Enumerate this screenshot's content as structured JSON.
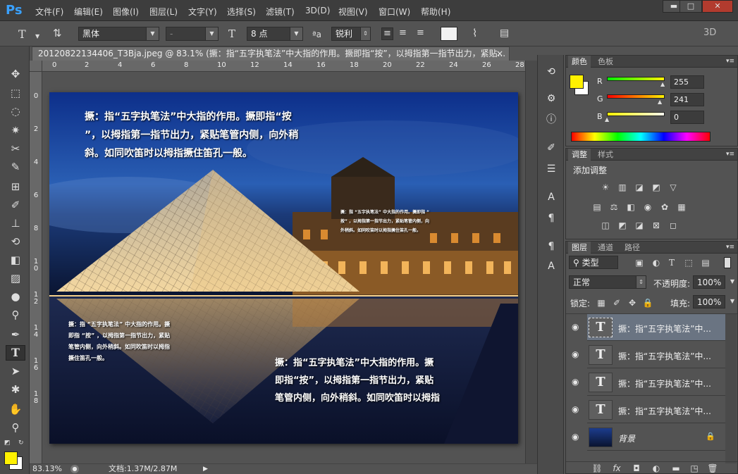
{
  "menubar": {
    "logo": "Ps",
    "items": [
      "文件(F)",
      "编辑(E)",
      "图像(I)",
      "图层(L)",
      "文字(Y)",
      "选择(S)",
      "滤镜(T)",
      "3D(D)",
      "视图(V)",
      "窗口(W)",
      "帮助(H)"
    ],
    "window_buttons": [
      "▬",
      "□",
      "✕"
    ]
  },
  "options": {
    "tool_glyph": "T",
    "font_family": "黑体",
    "font_style": "-",
    "font_size": "8 点",
    "aa_label": "ªa",
    "antialias": "锐利",
    "mode_3d": "3D"
  },
  "document": {
    "tab_title": "20120822134406_T3Bja.jpeg @ 83.1% (撅：指“五字执笔法”中大指的作用。撅即指“按”，以拇指第一指节出力，紧贴...",
    "close": "×",
    "zoom": "83.13%",
    "doc_size": "文档:1.37M/2.87M"
  },
  "ruler": {
    "top_labels": [
      "0",
      "2",
      "4",
      "6",
      "8",
      "10",
      "12",
      "14",
      "16",
      "18",
      "20",
      "22",
      "24",
      "26",
      "28"
    ],
    "left_labels": [
      "0",
      "2",
      "4",
      "6",
      "8",
      "1 0",
      "1 2",
      "1 4",
      "1 6",
      "1 8"
    ]
  },
  "image_text": {
    "top_left": "撅：指“五字执笔法”中大指的作用。撅即指“按\n”，以拇指第一指节出力，紧贴笔管内侧，向外稍\n斜。如同吹笛时以拇指撅住笛孔一般。",
    "mid_small": "撅：指 “五字执笔法” 中大指的作用。撅即指 “\n按” ，以拇指第一指节出力，紧贴笔管内侧，向\n外稍斜。如同吹笛时以拇指撅住笛孔一般。",
    "left_small": "撅：指 “五字执笔法” 中大指的作用。撅\n即指 “按” ，以拇指第一指节出力，紧贴\n笔管内侧，向外稍斜。如同吹笛时以拇指\n撅住笛孔一般。",
    "bottom_right": "撅：指“五字执笔法”中大指的作用。撅\n即指“按”，以拇指第一指节出力，紧贴\n笔管内侧，向外稍斜。如同吹笛时以拇指"
  },
  "color_panel": {
    "tabs": [
      "颜色",
      "色板"
    ],
    "channels": [
      {
        "label": "R",
        "value": "255",
        "level": 1.0
      },
      {
        "label": "G",
        "value": "241",
        "level": 0.945
      },
      {
        "label": "B",
        "value": "0",
        "level": 0.0
      }
    ],
    "foreground": "#fff100",
    "background": "#ffffff"
  },
  "adjust_panel": {
    "tabs": [
      "调整",
      "样式"
    ],
    "title": "添加调整"
  },
  "layers_panel": {
    "tabs": [
      "图层",
      "通道",
      "路径"
    ],
    "filter": "类型",
    "blend_mode": "正常",
    "opacity_label": "不透明度:",
    "opacity": "100%",
    "lock_label": "锁定:",
    "fill_label": "填充:",
    "fill": "100%",
    "layers": [
      {
        "name": "撅：指“五字执笔法”中...",
        "type": "text",
        "selected": true
      },
      {
        "name": "撅：指“五字执笔法”中...",
        "type": "text",
        "selected": false
      },
      {
        "name": "撅：指“五字执笔法”中...",
        "type": "text",
        "selected": false
      },
      {
        "name": "撅：指“五字执笔法”中...",
        "type": "text",
        "selected": false
      },
      {
        "name": "背景",
        "type": "image",
        "selected": false
      }
    ]
  },
  "colors": {
    "menubar": "#3d3d3d",
    "workspace": "#535353",
    "accent": "#fff100",
    "selected_layer": "#6a7482"
  }
}
